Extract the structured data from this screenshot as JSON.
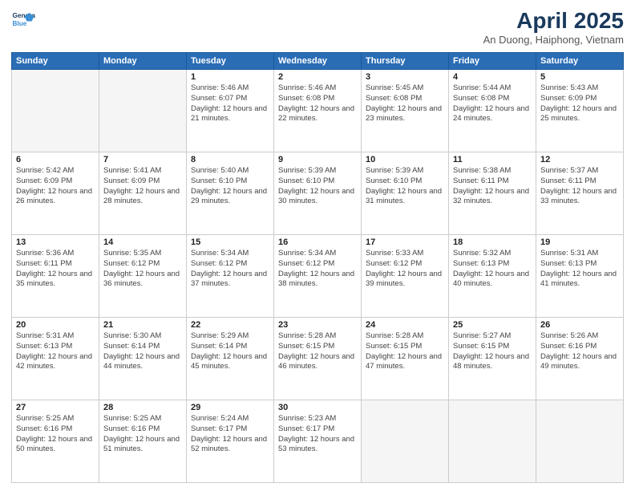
{
  "header": {
    "logo_line1": "General",
    "logo_line2": "Blue",
    "main_title": "April 2025",
    "sub_title": "An Duong, Haiphong, Vietnam"
  },
  "calendar": {
    "days_of_week": [
      "Sunday",
      "Monday",
      "Tuesday",
      "Wednesday",
      "Thursday",
      "Friday",
      "Saturday"
    ],
    "weeks": [
      [
        {
          "num": "",
          "info": ""
        },
        {
          "num": "",
          "info": ""
        },
        {
          "num": "1",
          "info": "Sunrise: 5:46 AM\nSunset: 6:07 PM\nDaylight: 12 hours and 21 minutes."
        },
        {
          "num": "2",
          "info": "Sunrise: 5:46 AM\nSunset: 6:08 PM\nDaylight: 12 hours and 22 minutes."
        },
        {
          "num": "3",
          "info": "Sunrise: 5:45 AM\nSunset: 6:08 PM\nDaylight: 12 hours and 23 minutes."
        },
        {
          "num": "4",
          "info": "Sunrise: 5:44 AM\nSunset: 6:08 PM\nDaylight: 12 hours and 24 minutes."
        },
        {
          "num": "5",
          "info": "Sunrise: 5:43 AM\nSunset: 6:09 PM\nDaylight: 12 hours and 25 minutes."
        }
      ],
      [
        {
          "num": "6",
          "info": "Sunrise: 5:42 AM\nSunset: 6:09 PM\nDaylight: 12 hours and 26 minutes."
        },
        {
          "num": "7",
          "info": "Sunrise: 5:41 AM\nSunset: 6:09 PM\nDaylight: 12 hours and 28 minutes."
        },
        {
          "num": "8",
          "info": "Sunrise: 5:40 AM\nSunset: 6:10 PM\nDaylight: 12 hours and 29 minutes."
        },
        {
          "num": "9",
          "info": "Sunrise: 5:39 AM\nSunset: 6:10 PM\nDaylight: 12 hours and 30 minutes."
        },
        {
          "num": "10",
          "info": "Sunrise: 5:39 AM\nSunset: 6:10 PM\nDaylight: 12 hours and 31 minutes."
        },
        {
          "num": "11",
          "info": "Sunrise: 5:38 AM\nSunset: 6:11 PM\nDaylight: 12 hours and 32 minutes."
        },
        {
          "num": "12",
          "info": "Sunrise: 5:37 AM\nSunset: 6:11 PM\nDaylight: 12 hours and 33 minutes."
        }
      ],
      [
        {
          "num": "13",
          "info": "Sunrise: 5:36 AM\nSunset: 6:11 PM\nDaylight: 12 hours and 35 minutes."
        },
        {
          "num": "14",
          "info": "Sunrise: 5:35 AM\nSunset: 6:12 PM\nDaylight: 12 hours and 36 minutes."
        },
        {
          "num": "15",
          "info": "Sunrise: 5:34 AM\nSunset: 6:12 PM\nDaylight: 12 hours and 37 minutes."
        },
        {
          "num": "16",
          "info": "Sunrise: 5:34 AM\nSunset: 6:12 PM\nDaylight: 12 hours and 38 minutes."
        },
        {
          "num": "17",
          "info": "Sunrise: 5:33 AM\nSunset: 6:12 PM\nDaylight: 12 hours and 39 minutes."
        },
        {
          "num": "18",
          "info": "Sunrise: 5:32 AM\nSunset: 6:13 PM\nDaylight: 12 hours and 40 minutes."
        },
        {
          "num": "19",
          "info": "Sunrise: 5:31 AM\nSunset: 6:13 PM\nDaylight: 12 hours and 41 minutes."
        }
      ],
      [
        {
          "num": "20",
          "info": "Sunrise: 5:31 AM\nSunset: 6:13 PM\nDaylight: 12 hours and 42 minutes."
        },
        {
          "num": "21",
          "info": "Sunrise: 5:30 AM\nSunset: 6:14 PM\nDaylight: 12 hours and 44 minutes."
        },
        {
          "num": "22",
          "info": "Sunrise: 5:29 AM\nSunset: 6:14 PM\nDaylight: 12 hours and 45 minutes."
        },
        {
          "num": "23",
          "info": "Sunrise: 5:28 AM\nSunset: 6:15 PM\nDaylight: 12 hours and 46 minutes."
        },
        {
          "num": "24",
          "info": "Sunrise: 5:28 AM\nSunset: 6:15 PM\nDaylight: 12 hours and 47 minutes."
        },
        {
          "num": "25",
          "info": "Sunrise: 5:27 AM\nSunset: 6:15 PM\nDaylight: 12 hours and 48 minutes."
        },
        {
          "num": "26",
          "info": "Sunrise: 5:26 AM\nSunset: 6:16 PM\nDaylight: 12 hours and 49 minutes."
        }
      ],
      [
        {
          "num": "27",
          "info": "Sunrise: 5:25 AM\nSunset: 6:16 PM\nDaylight: 12 hours and 50 minutes."
        },
        {
          "num": "28",
          "info": "Sunrise: 5:25 AM\nSunset: 6:16 PM\nDaylight: 12 hours and 51 minutes."
        },
        {
          "num": "29",
          "info": "Sunrise: 5:24 AM\nSunset: 6:17 PM\nDaylight: 12 hours and 52 minutes."
        },
        {
          "num": "30",
          "info": "Sunrise: 5:23 AM\nSunset: 6:17 PM\nDaylight: 12 hours and 53 minutes."
        },
        {
          "num": "",
          "info": ""
        },
        {
          "num": "",
          "info": ""
        },
        {
          "num": "",
          "info": ""
        }
      ]
    ]
  }
}
